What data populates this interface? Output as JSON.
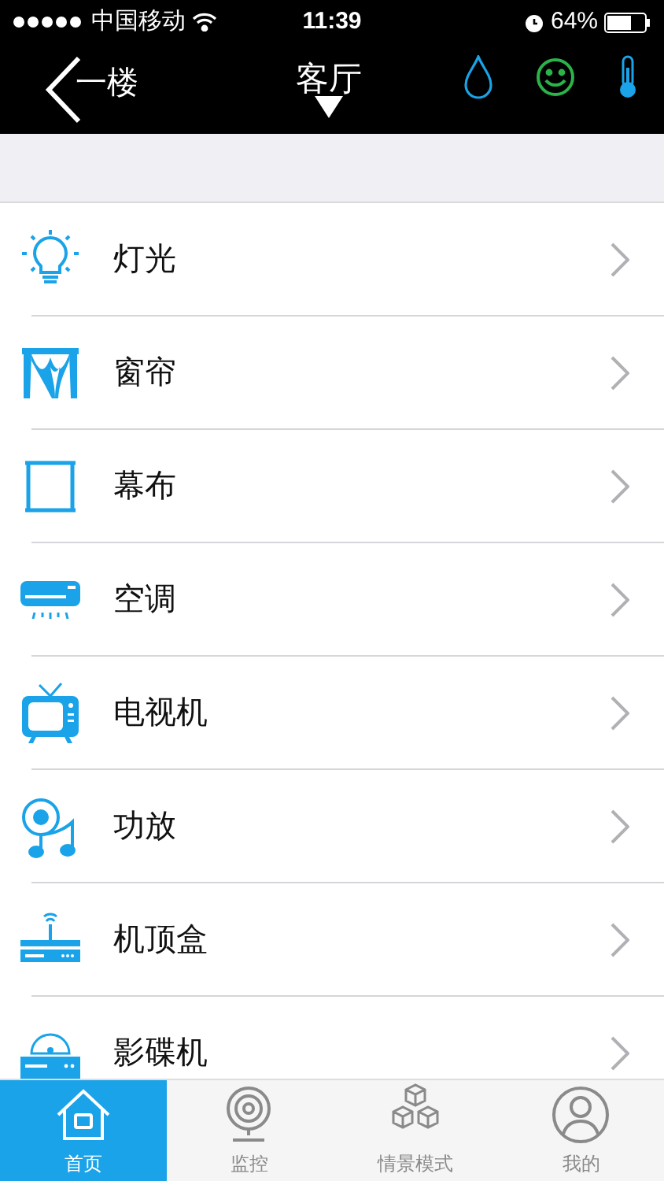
{
  "status_bar": {
    "carrier": "中国移动",
    "time": "11:39",
    "battery": "64%"
  },
  "nav_bar": {
    "back": "一楼",
    "title": "客厅"
  },
  "devices": [
    {
      "kind": "light",
      "label": "灯光"
    },
    {
      "kind": "curtain",
      "label": "窗帘"
    },
    {
      "kind": "screen",
      "label": "幕布"
    },
    {
      "kind": "ac",
      "label": "空调"
    },
    {
      "kind": "tv",
      "label": "电视机"
    },
    {
      "kind": "amplifier",
      "label": "功放"
    },
    {
      "kind": "settopbox",
      "label": "机顶盒"
    },
    {
      "kind": "dvd",
      "label": "影碟机"
    }
  ],
  "tabs": [
    {
      "kind": "home",
      "label": "首页",
      "selected": true
    },
    {
      "kind": "camera",
      "label": "监控",
      "selected": false
    },
    {
      "kind": "scenes",
      "label": "情景模式",
      "selected": false
    },
    {
      "kind": "profile",
      "label": "我的",
      "selected": false
    }
  ]
}
